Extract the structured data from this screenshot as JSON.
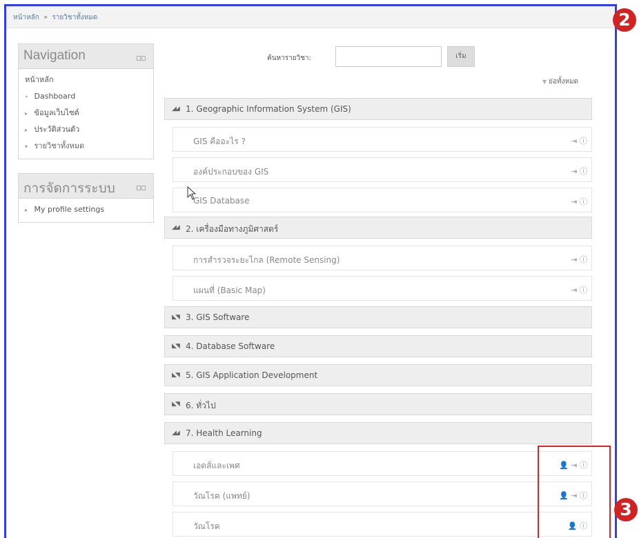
{
  "breadcrumb": {
    "home": "หน้าหลัก",
    "separator": "»",
    "current": "รายวิชาทั้งหมด"
  },
  "navigation": {
    "title": "Navigation",
    "items": [
      {
        "label": "หน้าหลัก",
        "marker": ""
      },
      {
        "label": "Dashboard",
        "marker": "•"
      },
      {
        "label": "ข้อมูลเว็บไซต์",
        "marker": "▸"
      },
      {
        "label": "ประวัติส่วนตัว",
        "marker": "▸"
      },
      {
        "label": "รายวิชาทั้งหมด",
        "marker": "▾"
      }
    ]
  },
  "admin": {
    "title": "การจัดการระบบ",
    "items": [
      {
        "label": "My profile settings",
        "marker": "▸"
      }
    ]
  },
  "search": {
    "label": "ค้นหารายวิชา:",
    "value": "",
    "button": "เริ่ม"
  },
  "collapse_all": "ย่อทั้งหมด",
  "sections": [
    {
      "title": "1. Geographic Information System (GIS)",
      "expanded": true
    },
    {
      "title": "2. เครื่องมือทางภูมิศาสตร์",
      "expanded": true
    },
    {
      "title": "3. GIS Software",
      "expanded": false
    },
    {
      "title": "4. Database Software",
      "expanded": false
    },
    {
      "title": "5. GIS Application Development",
      "expanded": false
    },
    {
      "title": "6. ทั่วไป",
      "expanded": false
    },
    {
      "title": "7. Health Learning",
      "expanded": true
    }
  ],
  "activities": [
    {
      "name": "GIS คืออะไร ?",
      "icons": "⇥ ⓘ"
    },
    {
      "name": "องค์ประกอบของ GIS",
      "icons": "⇥ ⓘ"
    },
    {
      "name": "GIS Database",
      "icons": "⇥ ⓘ"
    },
    {
      "name": "การสำรวจระยะไกล (Remote Sensing)",
      "icons": "⇥ ⓘ"
    },
    {
      "name": "แผนที่ (Basic Map)",
      "icons": "⇥ ⓘ"
    },
    {
      "name": "เอดส์และเพศ",
      "icons": "👤 ⇥ ⓘ"
    },
    {
      "name": "วัณโรค (แพทย์)",
      "icons": "👤 ⇥ ⓘ"
    },
    {
      "name": "วัณโรค",
      "icons": "👤 ⓘ"
    }
  ],
  "markers": {
    "top": "2",
    "bottom": "3"
  },
  "colors": {
    "frame": "#2f3df5",
    "highlight": "#e32323",
    "marker": "#d32222"
  }
}
